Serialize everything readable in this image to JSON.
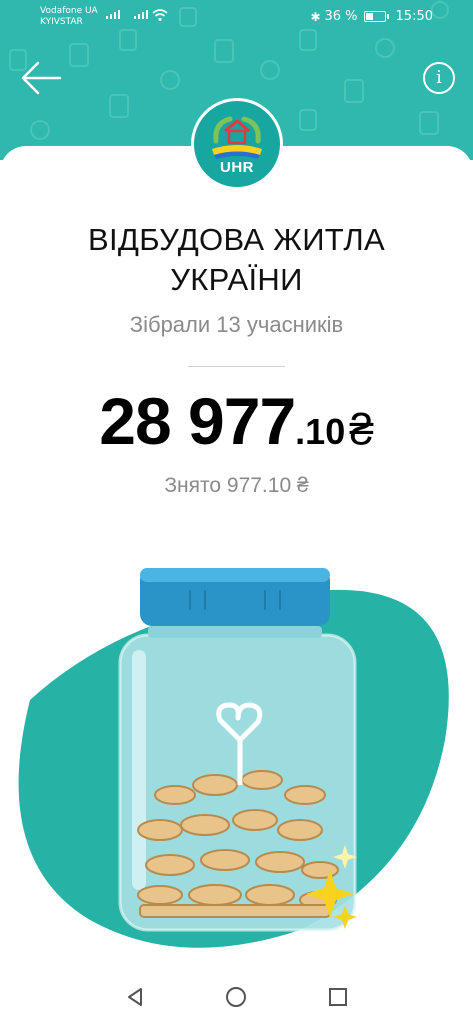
{
  "status_bar": {
    "carrier_1": "Vodafone UA",
    "carrier_2": "KYIVSTAR",
    "battery": "36 %",
    "time": "15:50",
    "battery_level": 0.36
  },
  "header": {
    "back_icon": "arrow-left-icon",
    "info_icon": "info-icon"
  },
  "logo": {
    "text": "UHR"
  },
  "jar": {
    "title_line1": "ВІДБУДОВА ЖИТЛА",
    "title_line2": "УКРАЇНИ",
    "members": "Зібрали 13 учасників",
    "amount_main": "28 977",
    "amount_cents": ".10",
    "currency": "₴",
    "withdrawn": "Знято 977.10 ₴"
  },
  "colors": {
    "accent": "#2fb8ad",
    "accent_dark": "#18a7a0",
    "jar_lid": "#2a93c7"
  },
  "nav": {
    "back_icon": "triangle-back-icon",
    "home_icon": "circle-home-icon",
    "recents_icon": "square-recents-icon"
  }
}
